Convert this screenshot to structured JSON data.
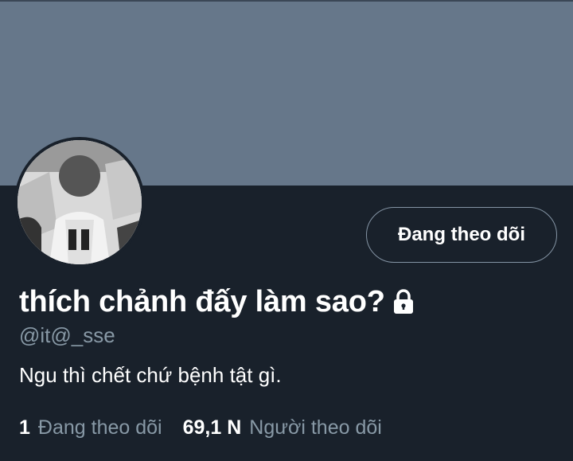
{
  "profile": {
    "display_name": "thích chảnh đấy làm sao?",
    "handle": "@it@_sse",
    "bio": "Ngu thì chết chứ bệnh tật gì.",
    "protected": true
  },
  "follow_button": {
    "label": "Đang theo dõi"
  },
  "stats": {
    "following_count": "1",
    "following_label": "Đang theo dõi",
    "followers_count": "69,1 N",
    "followers_label": "Người theo dõi"
  },
  "colors": {
    "banner": "#66778a",
    "background": "#19212b",
    "text_primary": "#ffffff",
    "text_secondary": "#8899a6",
    "button_border": "#8494a4"
  },
  "icons": {
    "lock": "lock-icon"
  }
}
